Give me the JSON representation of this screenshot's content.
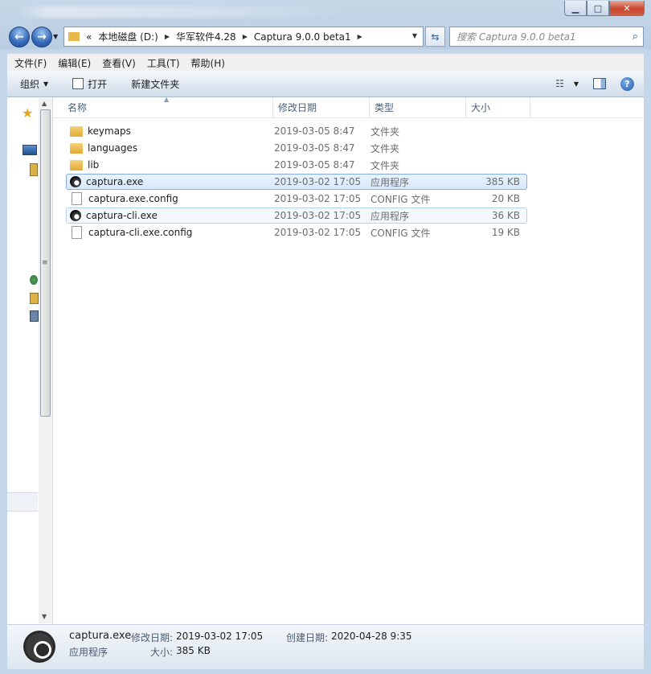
{
  "window": {
    "controls": {
      "minimize": "▁",
      "maximize": "□",
      "close": "✕"
    }
  },
  "nav": {
    "back_icon": "←",
    "forward_icon": "→",
    "address": {
      "overflow": "«",
      "segments": [
        "本地磁盘 (D:)",
        "华军软件4.28",
        "Captura 9.0.0 beta1"
      ]
    },
    "search_placeholder": "搜索 Captura 9.0.0 beta1"
  },
  "menu": [
    "文件(F)",
    "编辑(E)",
    "查看(V)",
    "工具(T)",
    "帮助(H)"
  ],
  "toolbar": {
    "organize": "组织",
    "open": "打开",
    "new_folder": "新建文件夹"
  },
  "columns": {
    "name": "名称",
    "date": "修改日期",
    "type": "类型",
    "size": "大小"
  },
  "files": [
    {
      "name": "keymaps",
      "date": "2019-03-05 8:47",
      "type": "文件夹",
      "size": "",
      "icon": "folder-icon"
    },
    {
      "name": "languages",
      "date": "2019-03-05 8:47",
      "type": "文件夹",
      "size": "",
      "icon": "folder-icon"
    },
    {
      "name": "lib",
      "date": "2019-03-05 8:47",
      "type": "文件夹",
      "size": "",
      "icon": "folder-icon"
    },
    {
      "name": "captura.exe",
      "date": "2019-03-02 17:05",
      "type": "应用程序",
      "size": "385 KB",
      "icon": "captura-app-icon"
    },
    {
      "name": "captura.exe.config",
      "date": "2019-03-02 17:05",
      "type": "CONFIG 文件",
      "size": "20 KB",
      "icon": "config-file-icon"
    },
    {
      "name": "captura-cli.exe",
      "date": "2019-03-02 17:05",
      "type": "应用程序",
      "size": "36 KB",
      "icon": "captura-app-icon"
    },
    {
      "name": "captura-cli.exe.config",
      "date": "2019-03-02 17:05",
      "type": "CONFIG 文件",
      "size": "19 KB",
      "icon": "config-file-icon"
    }
  ],
  "details": {
    "name": "captura.exe",
    "modified_label": "修改日期:",
    "modified": "2019-03-02 17:05",
    "created_label": "创建日期:",
    "created": "2020-04-28 9:35",
    "type": "应用程序",
    "size_label": "大小:",
    "size": "385 KB"
  },
  "colors": {
    "selection": "#d6e8fb",
    "selection_border": "#84acdd",
    "folder": "#e8b84a",
    "frame": "#c4d6e9"
  }
}
